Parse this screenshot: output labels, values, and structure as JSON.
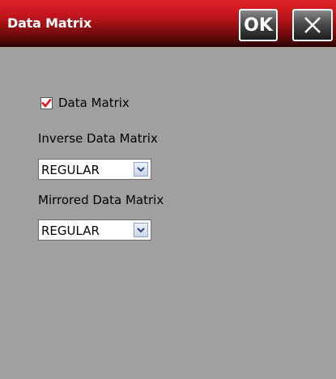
{
  "window": {
    "title": "Data Matrix",
    "ok_label": "OK",
    "close_icon": "close-icon",
    "title_bar_color": "#c0151b",
    "background_color": "#a19fa0"
  },
  "form": {
    "enable_checkbox": {
      "label": "Data Matrix",
      "checked": true,
      "check_color": "#e0161e"
    },
    "inverse": {
      "label": "Inverse Data Matrix",
      "value": "REGULAR"
    },
    "mirrored": {
      "label": "Mirrored Data Matrix",
      "value": "REGULAR"
    }
  }
}
